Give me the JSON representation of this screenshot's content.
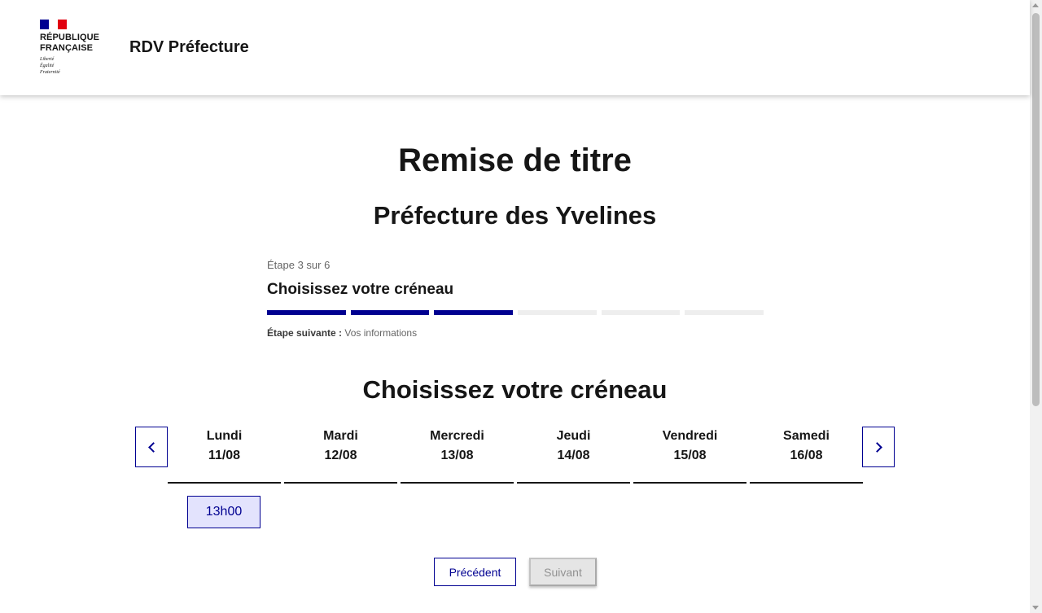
{
  "header": {
    "logo": {
      "line1": "RÉPUBLIQUE",
      "line2": "FRANÇAISE",
      "motto": [
        "Liberté",
        "Égalité",
        "Fraternité"
      ],
      "flag_colors": [
        "#000091",
        "#ffffff",
        "#e1000f"
      ]
    },
    "service_title": "RDV Préfecture"
  },
  "main": {
    "title": "Remise de titre",
    "subtitle": "Préfecture des Yvelines"
  },
  "stepper": {
    "state": "Étape 3 sur 6",
    "current_step": 3,
    "total_steps": 6,
    "title": "Choisissez votre créneau",
    "next_label": "Étape suivante :",
    "next_value": "Vos informations"
  },
  "calendar": {
    "title": "Choisissez votre créneau",
    "prev_icon": "chevron-left-icon",
    "next_icon": "chevron-right-icon",
    "days": [
      {
        "name": "Lundi",
        "date": "11/08"
      },
      {
        "name": "Mardi",
        "date": "12/08"
      },
      {
        "name": "Mercredi",
        "date": "13/08"
      },
      {
        "name": "Jeudi",
        "date": "14/08"
      },
      {
        "name": "Vendredi",
        "date": "15/08"
      },
      {
        "name": "Samedi",
        "date": "16/08"
      }
    ],
    "slots": [
      {
        "day": "Lundi",
        "time": "13h00"
      }
    ]
  },
  "actions": {
    "previous_label": "Précédent",
    "next_label": "Suivant"
  },
  "colors": {
    "primary": "#000091",
    "slot_background": "#e3e3fd",
    "disabled_background": "#e5e5e5",
    "disabled_text": "#929292"
  }
}
